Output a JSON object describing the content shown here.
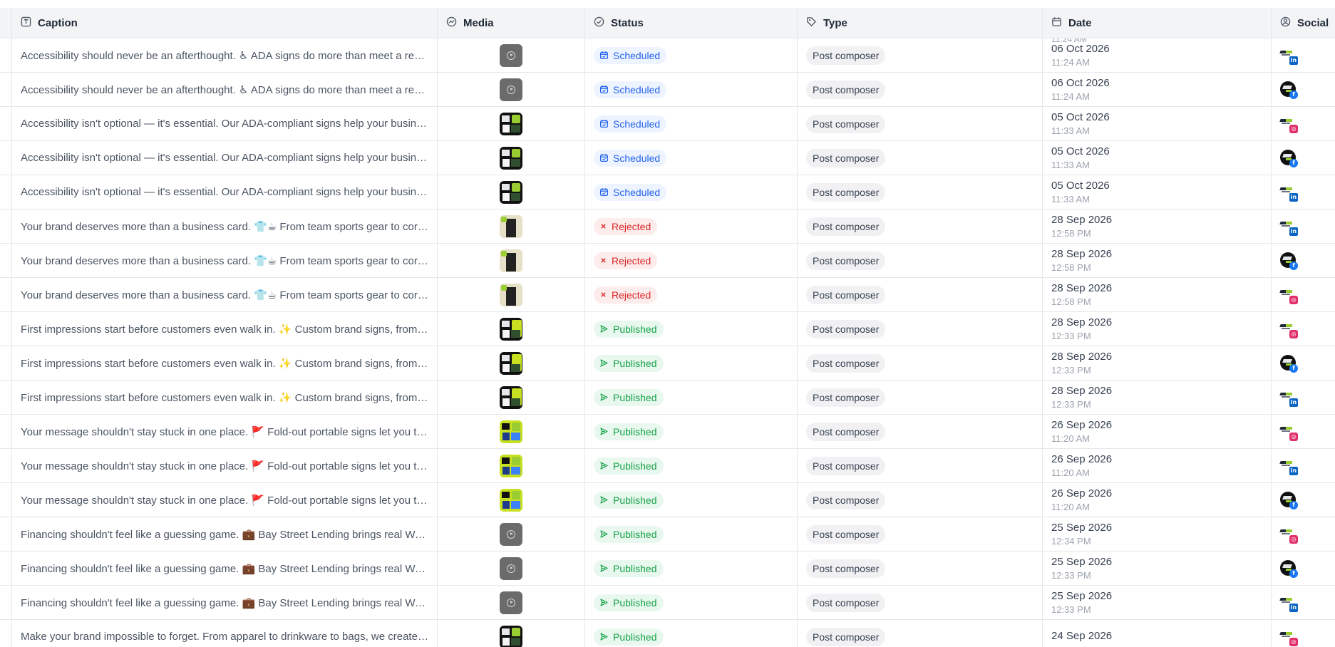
{
  "header": {
    "columns": [
      {
        "key": "caption",
        "label": "Caption",
        "icon": "text-field-icon"
      },
      {
        "key": "media",
        "label": "Media",
        "icon": "media-icon"
      },
      {
        "key": "status",
        "label": "Status",
        "icon": "check-circle-icon"
      },
      {
        "key": "type",
        "label": "Type",
        "icon": "tag-icon"
      },
      {
        "key": "date",
        "label": "Date",
        "icon": "calendar-icon"
      },
      {
        "key": "social",
        "label": "Social",
        "icon": "user-circle-icon"
      }
    ]
  },
  "peek_time": "11:24 AM",
  "colors": {
    "scheduled": "#2563eb",
    "rejected": "#dc2626",
    "published": "#16a34a",
    "linkedin": "#0a66c2",
    "facebook": "#1877f2",
    "instagram": "#e1306c"
  },
  "rows": [
    {
      "caption": "Accessibility should never be an afterthought. ♿ ADA signs do more than meet a requirement",
      "media": "video",
      "status": "Scheduled",
      "type": "Post composer",
      "date": "06 Oct 2026",
      "time": "11:24 AM",
      "avatar": "light",
      "network": "linkedin"
    },
    {
      "caption": "Accessibility should never be an afterthought. ♿ ADA signs do more than meet a requirement",
      "media": "video",
      "status": "Scheduled",
      "type": "Post composer",
      "date": "06 Oct 2026",
      "time": "11:24 AM",
      "avatar": "dark",
      "network": "facebook"
    },
    {
      "caption": "Accessibility isn't optional — it's essential. Our ADA-compliant signs help your business",
      "media": "image-1",
      "status": "Scheduled",
      "type": "Post composer",
      "date": "05 Oct 2026",
      "time": "11:33 AM",
      "avatar": "light",
      "network": "instagram"
    },
    {
      "caption": "Accessibility isn't optional — it's essential. Our ADA-compliant signs help your business",
      "media": "image-1",
      "status": "Scheduled",
      "type": "Post composer",
      "date": "05 Oct 2026",
      "time": "11:33 AM",
      "avatar": "dark",
      "network": "facebook"
    },
    {
      "caption": "Accessibility isn't optional — it's essential. Our ADA-compliant signs help your business",
      "media": "image-1",
      "status": "Scheduled",
      "type": "Post composer",
      "date": "05 Oct 2026",
      "time": "11:33 AM",
      "avatar": "light",
      "network": "linkedin"
    },
    {
      "caption": "Your brand deserves more than a business card. 👕☕ From team sports gear to corporate",
      "media": "image-3",
      "status": "Rejected",
      "type": "Post composer",
      "date": "28 Sep 2026",
      "time": "12:58 PM",
      "avatar": "light",
      "network": "linkedin"
    },
    {
      "caption": "Your brand deserves more than a business card. 👕☕ From team sports gear to corporate",
      "media": "image-3",
      "status": "Rejected",
      "type": "Post composer",
      "date": "28 Sep 2026",
      "time": "12:58 PM",
      "avatar": "dark",
      "network": "facebook"
    },
    {
      "caption": "Your brand deserves more than a business card. 👕☕ From team sports gear to corporate",
      "media": "image-3",
      "status": "Rejected",
      "type": "Post composer",
      "date": "28 Sep 2026",
      "time": "12:58 PM",
      "avatar": "light",
      "network": "instagram"
    },
    {
      "caption": "First impressions start before customers even walk in. ✨ Custom brand signs, from monument",
      "media": "image-2",
      "status": "Published",
      "type": "Post composer",
      "date": "28 Sep 2026",
      "time": "12:33 PM",
      "avatar": "light",
      "network": "instagram"
    },
    {
      "caption": "First impressions start before customers even walk in. ✨ Custom brand signs, from monument",
      "media": "image-2",
      "status": "Published",
      "type": "Post composer",
      "date": "28 Sep 2026",
      "time": "12:33 PM",
      "avatar": "dark",
      "network": "facebook"
    },
    {
      "caption": "First impressions start before customers even walk in. ✨ Custom brand signs, from monument",
      "media": "image-2",
      "status": "Published",
      "type": "Post composer",
      "date": "28 Sep 2026",
      "time": "12:33 PM",
      "avatar": "light",
      "network": "linkedin"
    },
    {
      "caption": "Your message shouldn't stay stuck in one place. 🚩 Fold-out portable signs let you take it",
      "media": "image-4",
      "status": "Published",
      "type": "Post composer",
      "date": "26 Sep 2026",
      "time": "11:20 AM",
      "avatar": "light",
      "network": "instagram"
    },
    {
      "caption": "Your message shouldn't stay stuck in one place. 🚩 Fold-out portable signs let you take it",
      "media": "image-4",
      "status": "Published",
      "type": "Post composer",
      "date": "26 Sep 2026",
      "time": "11:20 AM",
      "avatar": "light",
      "network": "linkedin"
    },
    {
      "caption": "Your message shouldn't stay stuck in one place. 🚩 Fold-out portable signs let you take it",
      "media": "image-4",
      "status": "Published",
      "type": "Post composer",
      "date": "26 Sep 2026",
      "time": "11:20 AM",
      "avatar": "dark",
      "network": "facebook"
    },
    {
      "caption": "Financing shouldn't feel like a guessing game. 💼 Bay Street Lending brings real Wall Street",
      "media": "video",
      "status": "Published",
      "type": "Post composer",
      "date": "25 Sep 2026",
      "time": "12:34 PM",
      "avatar": "light",
      "network": "instagram"
    },
    {
      "caption": "Financing shouldn't feel like a guessing game. 💼 Bay Street Lending brings real Wall Street",
      "media": "video",
      "status": "Published",
      "type": "Post composer",
      "date": "25 Sep 2026",
      "time": "12:33 PM",
      "avatar": "dark",
      "network": "facebook"
    },
    {
      "caption": "Financing shouldn't feel like a guessing game. 💼 Bay Street Lending brings real Wall Street",
      "media": "video",
      "status": "Published",
      "type": "Post composer",
      "date": "25 Sep 2026",
      "time": "12:33 PM",
      "avatar": "light",
      "network": "linkedin"
    },
    {
      "caption": "Make your brand impossible to forget. From apparel to drinkware to bags, we create custom",
      "media": "image-1",
      "status": "Published",
      "type": "Post composer",
      "date": "24 Sep 2026",
      "time": "",
      "avatar": "light",
      "network": "instagram"
    }
  ]
}
